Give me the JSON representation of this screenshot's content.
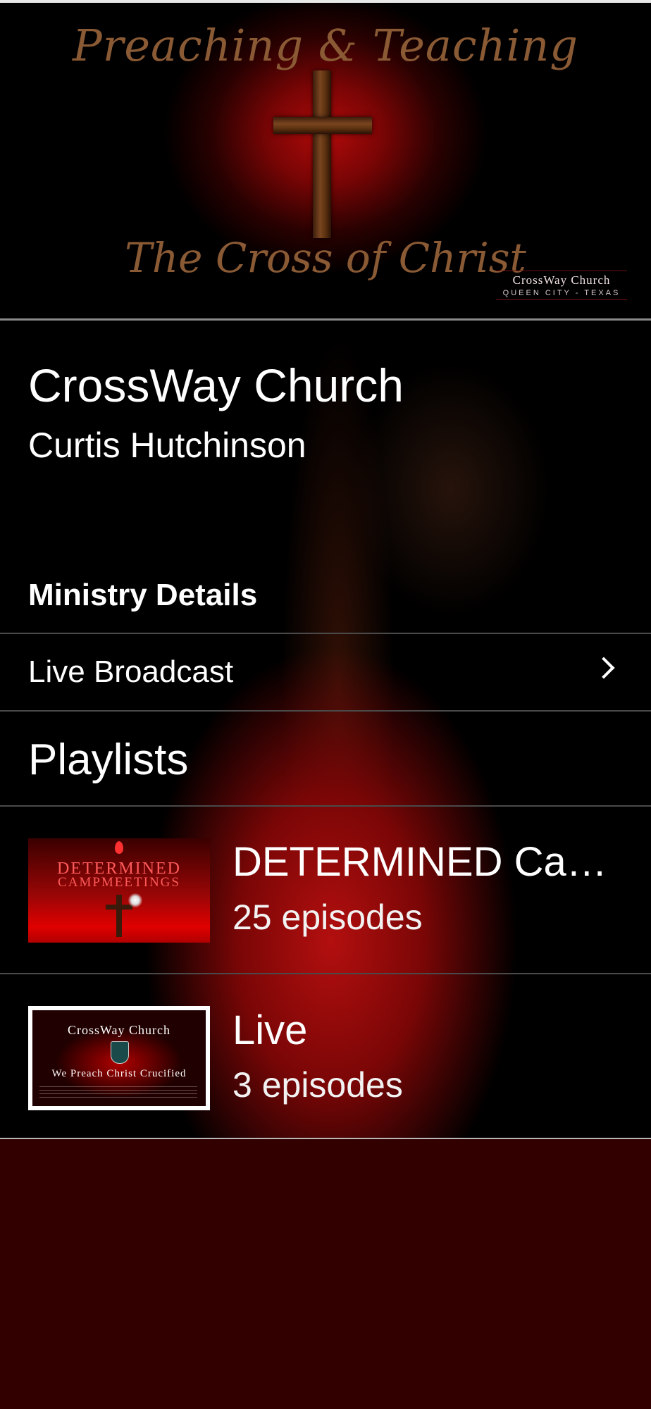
{
  "hero": {
    "title_top": "Preaching & Teaching",
    "title_bottom": "The Cross of Christ",
    "badge_name": "CrossWay Church",
    "badge_location": "QUEEN CITY - TEXAS"
  },
  "ministry": {
    "name": "CrossWay Church",
    "pastor": "Curtis Hutchinson",
    "details_heading": "Ministry Details",
    "live_broadcast_label": "Live Broadcast"
  },
  "playlists": {
    "heading": "Playlists",
    "items": [
      {
        "title": "DETERMINED Campmeetings",
        "episodes": "25 episodes",
        "thumb_line1": "DETERMINED",
        "thumb_line2": "CAMPMEETINGS"
      },
      {
        "title": "Live",
        "episodes": "3 episodes",
        "thumb_line1": "CrossWay Church",
        "thumb_line2": "We Preach Christ Crucified"
      }
    ]
  },
  "colors": {
    "accent": "#b00a0a",
    "background": "#330000",
    "hero_text": "#8a5a35",
    "text": "#ffffff"
  }
}
